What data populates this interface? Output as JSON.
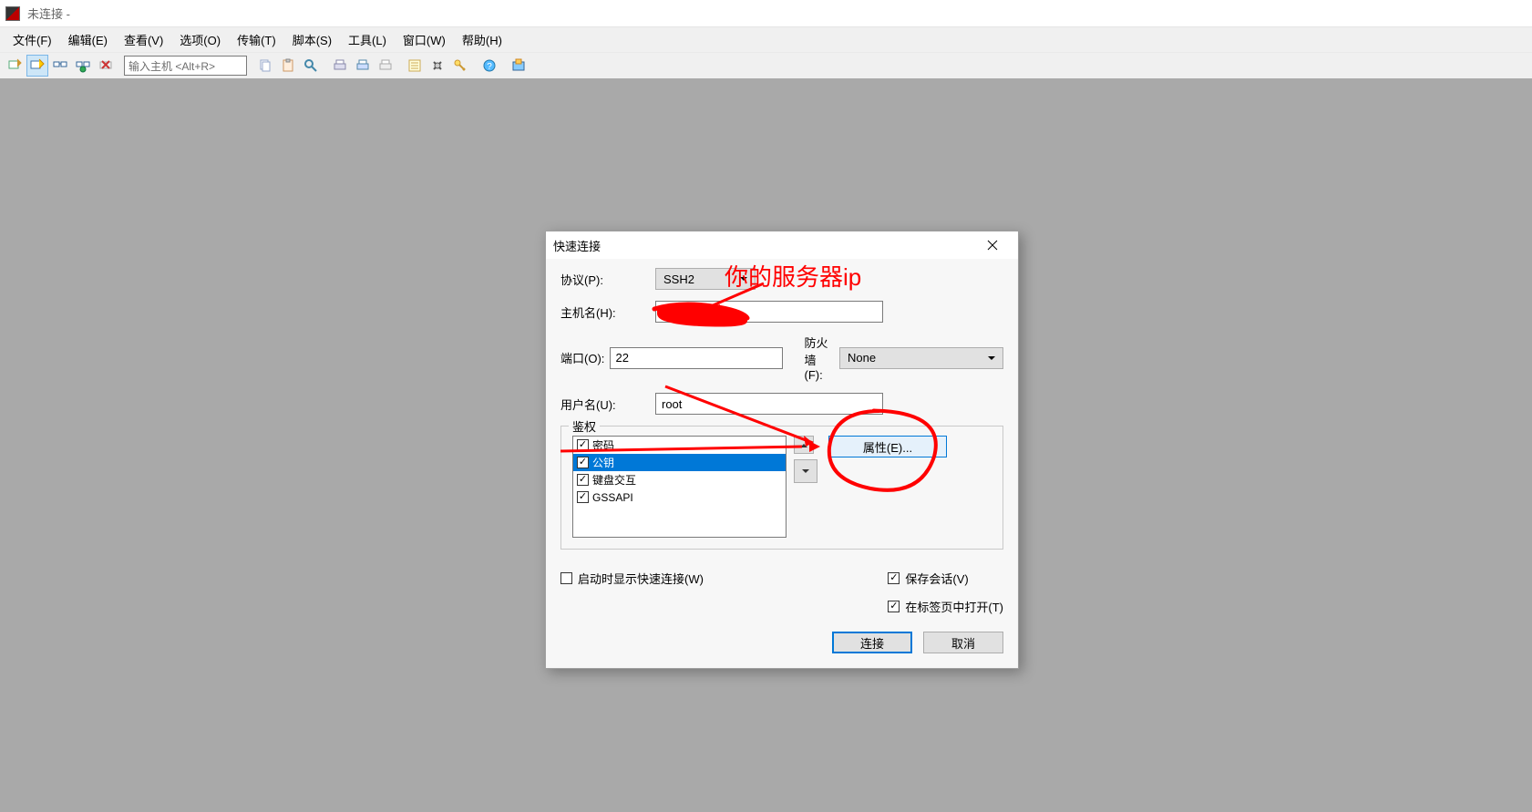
{
  "window": {
    "title": "未连接 -"
  },
  "menu": {
    "file": "文件(F)",
    "edit": "编辑(E)",
    "view": "查看(V)",
    "option": "选项(O)",
    "transfer": "传输(T)",
    "script": "脚本(S)",
    "tools": "工具(L)",
    "window": "窗口(W)",
    "help": "帮助(H)"
  },
  "toolbar": {
    "host_placeholder": "输入主机 <Alt+R>"
  },
  "dialog": {
    "title": "快速连接",
    "labels": {
      "protocol": "协议(P):",
      "hostname": "主机名(H):",
      "port": "端口(O):",
      "firewall": "防火墙(F):",
      "username": "用户名(U):",
      "auth_group": "鉴权",
      "properties": "属性(E)...",
      "show_on_start": "启动时显示快速连接(W)",
      "save_session": "保存会话(V)",
      "open_in_tab": "在标签页中打开(T)",
      "connect": "连接",
      "cancel": "取消"
    },
    "values": {
      "protocol": "SSH2",
      "hostname": "",
      "port": "22",
      "firewall": "None",
      "username": "root"
    },
    "auth_methods": [
      {
        "label": "密码",
        "checked": true,
        "selected": false
      },
      {
        "label": "公钥",
        "checked": true,
        "selected": true
      },
      {
        "label": "键盘交互",
        "checked": true,
        "selected": false
      },
      {
        "label": "GSSAPI",
        "checked": true,
        "selected": false
      }
    ],
    "checks": {
      "show_on_start": false,
      "save_session": true,
      "open_in_tab": true
    }
  },
  "annotation": {
    "server_ip": "你的服务器ip"
  }
}
